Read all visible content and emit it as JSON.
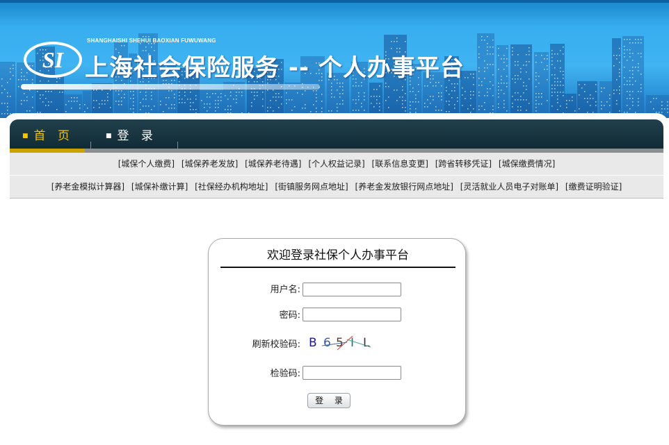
{
  "header": {
    "logo_text": "SI",
    "pinyin": "SHANGHAISHI SHEHUI BAOXIAN FUWUWANG",
    "site_title": "上海社会保险服务 -- 个人办事平台"
  },
  "nav": {
    "items": [
      {
        "label": "首 页",
        "active": true
      },
      {
        "label": "登 录",
        "active": false
      }
    ],
    "active_color": "#f5c400"
  },
  "quick_links": {
    "row1": [
      "[城保个人缴费]",
      "[城保养老发放]",
      "[城保养老待遇]",
      "[个人权益记录]",
      "[联系信息变更]",
      "[跨省转移凭证]",
      "[城保缴费情况]"
    ],
    "row2": [
      "[养老金模拟计算器]",
      "[城保补缴计算]",
      "[社保经办机构地址]",
      "[街镇服务网点地址]",
      "[养老金发放银行网点地址]",
      "[灵活就业人员电子对账单]",
      "[缴费证明验证]"
    ]
  },
  "login": {
    "title": "欢迎登录社保个人办事平台",
    "username_label": "用户名:",
    "username_value": "",
    "password_label": "密码:",
    "password_value": "",
    "refresh_captcha_label": "刷新校验码:",
    "captcha_chars": [
      "B",
      "6",
      "5",
      "I",
      "L"
    ],
    "captcha_input_label": "检验码:",
    "captcha_input_value": "",
    "submit_label": "登 录"
  },
  "colors": {
    "banner_blue": "#37aef0",
    "navbar_dark": "#0d2833",
    "link_strip": "#e9e9e9"
  }
}
